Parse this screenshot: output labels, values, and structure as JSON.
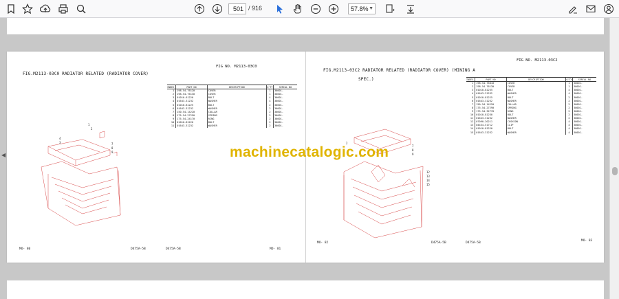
{
  "toolbar": {
    "page_current": "501",
    "page_total": "/ 916",
    "zoom": "57.8%",
    "tools": [
      "bookmark-icon",
      "star-icon",
      "upload-icon",
      "print-icon",
      "zoom-search-icon",
      "page-up-icon",
      "page-down-icon",
      "select-cursor-icon",
      "hand-icon",
      "zoom-out-icon",
      "zoom-in-icon",
      "fit-page-icon",
      "download-icon",
      "sign-icon",
      "email-icon",
      "account-icon"
    ]
  },
  "left_page": {
    "fig_title": "FIG.M2113-03C0  RADIATOR RELATED (RADIATOR COVER)",
    "fig_no": "FIG NO.  M2113-03C0",
    "columns": [
      "INDEX",
      "PART NO",
      "DESCRIPTION",
      "Q'TY",
      "SERIAL NO"
    ],
    "rows": [
      [
        "1",
        "198-54-76120",
        "COVER",
        "1",
        "30001-"
      ],
      [
        "2",
        "198-54-76130",
        "COVER",
        "1",
        "30001-"
      ],
      [
        "3",
        "01010-61220",
        "BOLT",
        "4",
        "30001-"
      ],
      [
        "4",
        "01643-31232",
        "WASHER",
        "4",
        "30001-"
      ],
      [
        "5",
        "01010-81225",
        "BOLT",
        "2",
        "30001-"
      ],
      [
        "6",
        "01643-31232",
        "WASHER",
        "2",
        "30001-"
      ],
      [
        "7",
        "150-54-14220",
        "COLLAR",
        "2",
        "30001-"
      ],
      [
        "8",
        "175-54-27290",
        "SPRING",
        "2",
        "30001-"
      ],
      [
        "9",
        "175-54-24170",
        "RING",
        "2",
        "30001-"
      ],
      [
        "10",
        "01010-81220",
        "BOLT",
        "2",
        "30001-"
      ],
      [
        "11",
        "01643-31232",
        "WASHER",
        "2",
        "30001-"
      ]
    ],
    "footer_left": "MO- 80",
    "footer_mid": "D475A-5B",
    "footer_right": "MO- 81"
  },
  "right_page": {
    "fig_title_1": "FIG.M2113-03C2  RADIATOR RELATED (RADIATOR COVER) (MINING A",
    "fig_title_2": "SPEC.)",
    "fig_no": "FIG NO.  M2113-03C2",
    "columns": [
      "INDEX",
      "PART NO",
      "DESCRIPTION",
      "Q'TY",
      "SERIAL NO"
    ],
    "rows": [
      [
        "1",
        "198-54-76810",
        "COVER",
        "1",
        "30001-"
      ],
      [
        "2",
        "198-54-76130",
        "COVER",
        "1",
        "30001-"
      ],
      [
        "3",
        "01010-81235",
        "BOLT",
        "4",
        "30001-"
      ],
      [
        "4",
        "01643-31232",
        "WASHER",
        "4",
        "30001-"
      ],
      [
        "5",
        "01010-81225",
        "BOLT",
        "2",
        "30001-"
      ],
      [
        "6",
        "01643-31232",
        "WASHER",
        "2",
        "30001-"
      ],
      [
        "7",
        "150-54-14220",
        "COLLAR",
        "2",
        "30001-"
      ],
      [
        "8",
        "175-54-27290",
        "SPRING",
        "2",
        "30001-"
      ],
      [
        "9",
        "175-54-32770",
        "RING",
        "2",
        "30001-"
      ],
      [
        "10",
        "01010-81230",
        "BOLT",
        "2",
        "30001-"
      ],
      [
        "11",
        "01643-31232",
        "WASHER",
        "2",
        "30001-"
      ],
      [
        "12",
        "07090-20211",
        "CUSHION",
        "4",
        "30001-"
      ],
      [
        "13",
        "04434-51712",
        "CLIP",
        "4",
        "30001-"
      ],
      [
        "14",
        "01010-81220",
        "BOLT",
        "4",
        "30001-"
      ],
      [
        "15",
        "01643-31232",
        "WASHER",
        "4",
        "30001-"
      ]
    ],
    "footer_left": "MO- 82",
    "footer_mid": "D475A-5B",
    "footer_right": "MO- 83"
  },
  "watermark": "machinecatalogic.com",
  "colors": {
    "watermark": "#e0b400",
    "drawing": "#d84a4a",
    "toolbar": "#f9f9fa"
  }
}
